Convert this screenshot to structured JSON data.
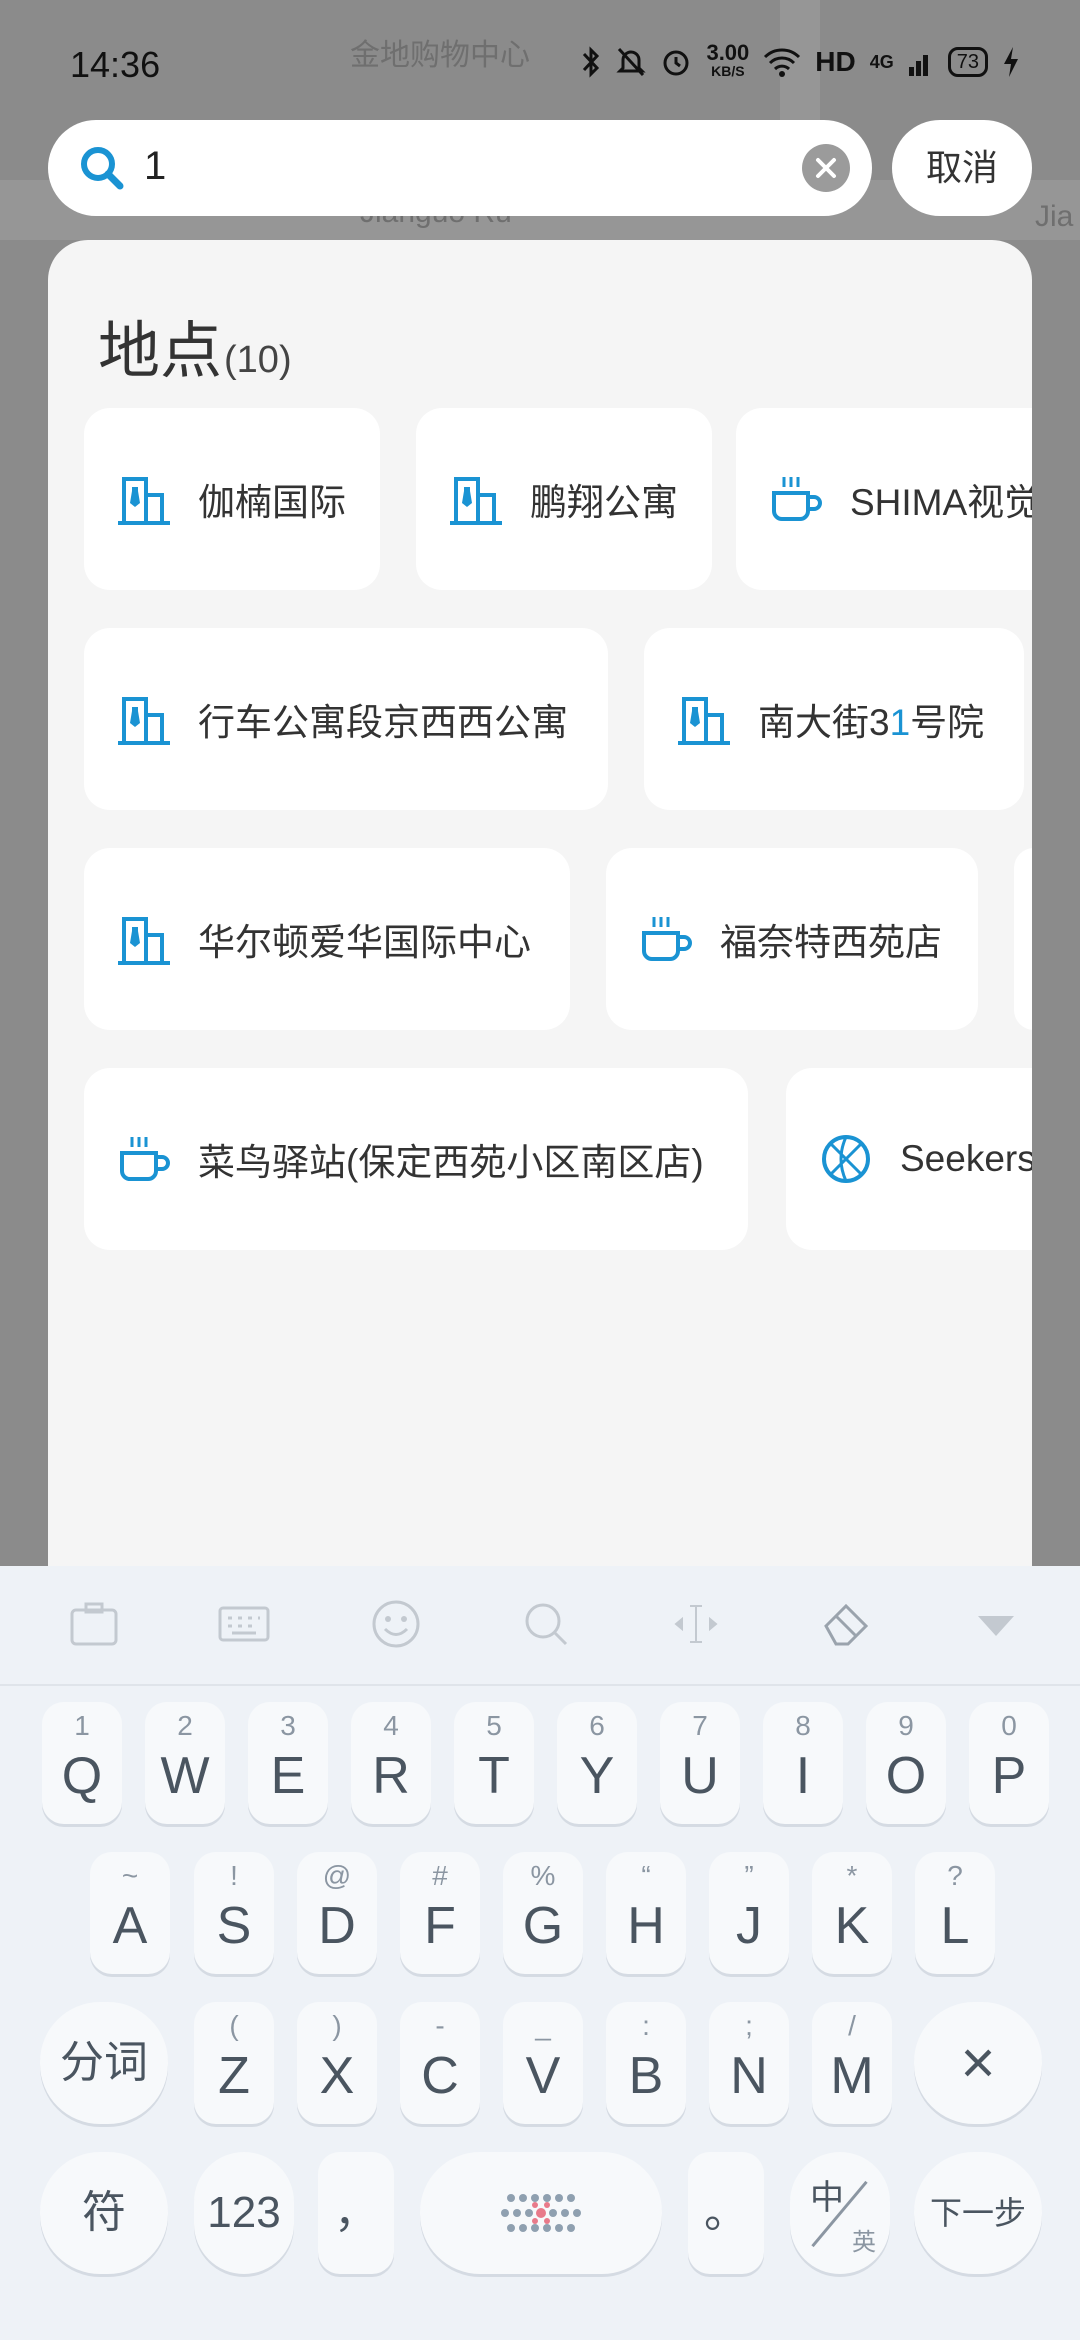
{
  "status_bar": {
    "time": "14:36",
    "net_speed_value": "3.00",
    "net_speed_unit": "KB/S",
    "hd": "HD",
    "network": "4G",
    "battery": "73",
    "icons": [
      "bluetooth-icon",
      "mute-icon",
      "alarm-icon",
      "wifi-icon",
      "signal-icon",
      "charging-icon"
    ]
  },
  "map_labels": [
    "金地购物中心",
    "Jianguo Ru",
    "Jia"
  ],
  "search": {
    "value": "1",
    "cancel_label": "取消"
  },
  "places": {
    "title": "地点",
    "count": "(10)",
    "items": [
      {
        "icon": "building-icon",
        "label": "伽楠国际"
      },
      {
        "icon": "building-icon",
        "label": "鹏翔公寓"
      },
      {
        "icon": "coffee-icon",
        "label": "SHIMA视觉"
      },
      {
        "icon": "building-icon",
        "label": "行车公寓段京西西公寓"
      },
      {
        "icon": "building-icon",
        "label_pre": "南大街3",
        "label_hl": "1",
        "label_post": "号院"
      },
      {
        "icon": "building-icon",
        "label": "华尔顿爱华国际中心"
      },
      {
        "icon": "coffee-icon",
        "label": "福奈特西苑店"
      },
      {
        "icon": "coffee-icon",
        "label": "菜鸟驿站(保定西苑小区南区店)"
      },
      {
        "icon": "basketball-icon",
        "label": "Seekers"
      }
    ]
  },
  "keyboard": {
    "toolbar_icons": [
      "clipboard-icon",
      "keyboard-icon",
      "emoji-icon",
      "search-icon",
      "cursor-icon",
      "clear-icon",
      "hide-keyboard-icon"
    ],
    "row1": [
      {
        "main": "Q",
        "sub": "1"
      },
      {
        "main": "W",
        "sub": "2"
      },
      {
        "main": "E",
        "sub": "3"
      },
      {
        "main": "R",
        "sub": "4"
      },
      {
        "main": "T",
        "sub": "5"
      },
      {
        "main": "Y",
        "sub": "6"
      },
      {
        "main": "U",
        "sub": "7"
      },
      {
        "main": "I",
        "sub": "8"
      },
      {
        "main": "O",
        "sub": "9"
      },
      {
        "main": "P",
        "sub": "0"
      }
    ],
    "row2": [
      {
        "main": "A",
        "sub": "~"
      },
      {
        "main": "S",
        "sub": "!"
      },
      {
        "main": "D",
        "sub": "@"
      },
      {
        "main": "F",
        "sub": "#"
      },
      {
        "main": "G",
        "sub": "%"
      },
      {
        "main": "H",
        "sub": "“"
      },
      {
        "main": "J",
        "sub": "”"
      },
      {
        "main": "K",
        "sub": "*"
      },
      {
        "main": "L",
        "sub": "?"
      }
    ],
    "row3": [
      {
        "main": "Z",
        "sub": "("
      },
      {
        "main": "X",
        "sub": ")"
      },
      {
        "main": "C",
        "sub": "-"
      },
      {
        "main": "V",
        "sub": "_"
      },
      {
        "main": "B",
        "sub": ":"
      },
      {
        "main": "N",
        "sub": ";"
      },
      {
        "main": "M",
        "sub": "/"
      }
    ],
    "segment_label": "分词",
    "delete_symbol": "×",
    "symbols_label": "符",
    "numbers_label": "123",
    "comma_label": "，",
    "period_label": "。",
    "lang_top": "中",
    "lang_bottom": "英",
    "next_label": "下一步"
  }
}
